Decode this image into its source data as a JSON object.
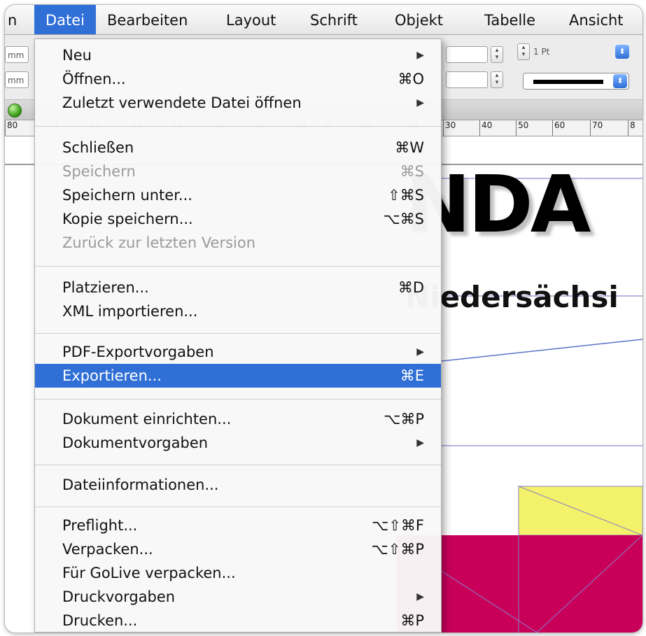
{
  "menubar": {
    "items": [
      {
        "label": "n"
      },
      {
        "label": "Datei"
      },
      {
        "label": "Bearbeiten"
      },
      {
        "label": "Layout"
      },
      {
        "label": "Schrift"
      },
      {
        "label": "Objekt"
      },
      {
        "label": "Tabelle"
      },
      {
        "label": "Ansicht"
      }
    ]
  },
  "toolbar": {
    "unit_top": "mm",
    "unit_bottom": "mm",
    "stroke_weight": "1 Pt"
  },
  "ruler": {
    "ticks": [
      "80",
      "70",
      "60",
      "50",
      "40",
      "30",
      "20",
      "10",
      "0",
      "10",
      "20",
      "30",
      "40",
      "50",
      "60",
      "70",
      "8"
    ]
  },
  "document": {
    "heading": "NDA",
    "subheading": "Niedersächsi"
  },
  "menu": {
    "items": [
      {
        "label": "Neu",
        "shortcut": "",
        "submenu": true,
        "disabled": false
      },
      {
        "label": "Öffnen...",
        "shortcut": "⌘O",
        "submenu": false,
        "disabled": false
      },
      {
        "label": "Zuletzt verwendete Datei öffnen",
        "shortcut": "",
        "submenu": true,
        "disabled": false
      },
      {
        "label": "Schließen",
        "shortcut": "⌘W",
        "submenu": false,
        "disabled": false
      },
      {
        "label": "Speichern",
        "shortcut": "⌘S",
        "submenu": false,
        "disabled": true
      },
      {
        "label": "Speichern unter...",
        "shortcut": "⇧⌘S",
        "submenu": false,
        "disabled": false
      },
      {
        "label": "Kopie speichern...",
        "shortcut": "⌥⌘S",
        "submenu": false,
        "disabled": false
      },
      {
        "label": "Zurück zur letzten Version",
        "shortcut": "",
        "submenu": false,
        "disabled": true
      },
      {
        "label": "Platzieren...",
        "shortcut": "⌘D",
        "submenu": false,
        "disabled": false
      },
      {
        "label": "XML importieren...",
        "shortcut": "",
        "submenu": false,
        "disabled": false
      },
      {
        "label": "PDF-Exportvorgaben",
        "shortcut": "",
        "submenu": true,
        "disabled": false
      },
      {
        "label": "Exportieren...",
        "shortcut": "⌘E",
        "submenu": false,
        "disabled": false,
        "highlighted": true
      },
      {
        "label": "Dokument einrichten...",
        "shortcut": "⌥⌘P",
        "submenu": false,
        "disabled": false
      },
      {
        "label": "Dokumentvorgaben",
        "shortcut": "",
        "submenu": true,
        "disabled": false
      },
      {
        "label": "Dateiinformationen...",
        "shortcut": "",
        "submenu": false,
        "disabled": false
      },
      {
        "label": "Preflight...",
        "shortcut": "⌥⇧⌘F",
        "submenu": false,
        "disabled": false
      },
      {
        "label": "Verpacken...",
        "shortcut": "⌥⇧⌘P",
        "submenu": false,
        "disabled": false
      },
      {
        "label": "Für GoLive verpacken...",
        "shortcut": "",
        "submenu": false,
        "disabled": false
      },
      {
        "label": "Druckvorgaben",
        "shortcut": "",
        "submenu": true,
        "disabled": false
      },
      {
        "label": "Drucken...",
        "shortcut": "⌘P",
        "submenu": false,
        "disabled": false
      }
    ],
    "submenu_arrow": "▶"
  },
  "colors": {
    "highlight": "#2f6fd6",
    "yellow_frame": "#f4f26a",
    "magenta_frame": "#c8005a"
  }
}
